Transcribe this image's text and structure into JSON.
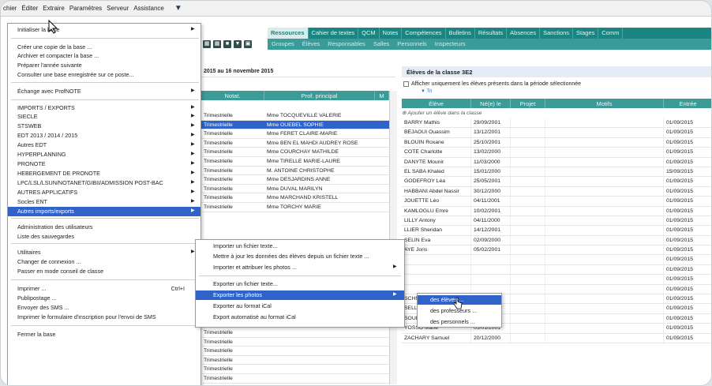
{
  "menubar": {
    "items": [
      "chier",
      "Éditer",
      "Extraire",
      "Paramètres",
      "Serveur",
      "Assistance"
    ]
  },
  "nav": {
    "tabs": [
      "Ressources",
      "Cahier de textes",
      "QCM",
      "Notes",
      "Compétences",
      "Bulletins",
      "Résultats",
      "Absences",
      "Sanctions",
      "Stages",
      "Comm"
    ],
    "subtabs": [
      "Groupes",
      "Élèves",
      "Responsables",
      "Salles",
      "Personnels",
      "Inspecteurs"
    ]
  },
  "file_menu": {
    "items": [
      {
        "label": "Initialiser la base",
        "arrow": "▶",
        "shortcut": ""
      },
      {
        "label": "Créer une copie de la base ...",
        "arrow": "",
        "shortcut": ""
      },
      {
        "label": "Archiver et compacter la base ...",
        "arrow": "",
        "shortcut": ""
      },
      {
        "label": "Préparer l'année suivante",
        "arrow": "",
        "shortcut": ""
      },
      {
        "label": "Consulter une base enregistrée sur ce poste...",
        "arrow": "",
        "shortcut": ""
      },
      {
        "label": "Échange avec ProfNOTE",
        "arrow": "▶",
        "shortcut": ""
      },
      {
        "label": "IMPORTS / EXPORTS",
        "arrow": "▶",
        "shortcut": ""
      },
      {
        "label": "SIECLE",
        "arrow": "▶",
        "shortcut": ""
      },
      {
        "label": "STSWEB",
        "arrow": "▶",
        "shortcut": ""
      },
      {
        "label": "EDT 2013 / 2014 / 2015",
        "arrow": "▶",
        "shortcut": ""
      },
      {
        "label": "Autres EDT",
        "arrow": "▶",
        "shortcut": ""
      },
      {
        "label": "HYPERPLANNING",
        "arrow": "▶",
        "shortcut": ""
      },
      {
        "label": "PRONOTE",
        "arrow": "▶",
        "shortcut": ""
      },
      {
        "label": "HEBERGEMENT DE PRONOTE",
        "arrow": "▶",
        "shortcut": ""
      },
      {
        "label": "LPC/LSL/LSUN/NOTANET/GIBII/ADMISSION POST-BAC",
        "arrow": "▶",
        "shortcut": ""
      },
      {
        "label": "AUTRES APPLICATIFS",
        "arrow": "▶",
        "shortcut": ""
      },
      {
        "label": "Socles ENT",
        "arrow": "▶",
        "shortcut": ""
      },
      {
        "label": "Autres imports/exports",
        "arrow": "▶",
        "shortcut": ""
      },
      {
        "label": "Administration des utilisateurs",
        "arrow": "",
        "shortcut": ""
      },
      {
        "label": "Liste des sauvegardes",
        "arrow": "",
        "shortcut": ""
      },
      {
        "label": "Utilitaires",
        "arrow": "▶",
        "shortcut": ""
      },
      {
        "label": "Changer de connexion ...",
        "arrow": "",
        "shortcut": ""
      },
      {
        "label": "Passer en mode conseil de classe",
        "arrow": "",
        "shortcut": ""
      },
      {
        "label": "Imprimer ...",
        "arrow": "",
        "shortcut": "Ctrl+I"
      },
      {
        "label": "Publipostage ...",
        "arrow": "",
        "shortcut": ""
      },
      {
        "label": "Envoyer des SMS ...",
        "arrow": "",
        "shortcut": ""
      },
      {
        "label": "Imprimer le formulaire d'inscription pour l'envoi de SMS",
        "arrow": "",
        "shortcut": ""
      },
      {
        "label": "Fermer la base",
        "arrow": "",
        "shortcut": ""
      }
    ]
  },
  "submenu": {
    "items": [
      {
        "label": "Importer un fichier texte...",
        "arrow": ""
      },
      {
        "label": "Mettre à jour les données des élèves depuis un fichier texte ...",
        "arrow": ""
      },
      {
        "label": "Importer et attribuer les photos ...",
        "arrow": "▶"
      },
      {
        "label": "Exporter un fichier texte...",
        "arrow": ""
      },
      {
        "label": "Exporter les photos",
        "arrow": "▶"
      },
      {
        "label": "Exporter au format iCal",
        "arrow": ""
      },
      {
        "label": "Export automatisé au format iCal",
        "arrow": ""
      }
    ]
  },
  "subsubmenu": {
    "items": [
      "des élèves ...",
      "des professeurs ...",
      "des personnels ..."
    ]
  },
  "middle_panel": {
    "header": "2015 au 16 novembre 2015",
    "col_notat": "Notat.",
    "col_prof": "Prof. principal",
    "col_m": "M",
    "rows": [
      {
        "notat": "Trimestrielle",
        "prof": "Mme TOCQUEVILLE VALERIE"
      },
      {
        "notat": "Trimestrielle",
        "prof": "Mme OUEBEL SOPHIE"
      },
      {
        "notat": "Trimestrielle",
        "prof": "Mme FERET CLAIRE-MARIE"
      },
      {
        "notat": "Trimestrielle",
        "prof": "Mme BEN EL MAHDI AUDREY ROSE"
      },
      {
        "notat": "Trimestrielle",
        "prof": "Mme COURCHAY MATHILDE"
      },
      {
        "notat": "Trimestrielle",
        "prof": "Mme TIRELLE MARIE-LAURE"
      },
      {
        "notat": "Trimestrielle",
        "prof": "M. ANTOINE CHRISTOPHE"
      },
      {
        "notat": "Trimestrielle",
        "prof": "Mme DESJARDINS ANNE"
      },
      {
        "notat": "Trimestrielle",
        "prof": "Mme DUVAL MARILYN"
      },
      {
        "notat": "Trimestrielle",
        "prof": "Mme MARCHAND KRISTELL"
      },
      {
        "notat": "Trimestrielle",
        "prof": "Mme TORCHY MARIE"
      }
    ],
    "bottom_rows": [
      "Trimestrielle",
      "Trimestrielle",
      "Trimestrielle",
      "Trimestrielle",
      "Trimestrielle",
      "Trimestrielle"
    ]
  },
  "right_panel": {
    "header": "Élèves de la classe 3E2",
    "checkbox_label": "Afficher uniquement les élèves présents dans la période sélectionnée",
    "sort_label": "Tri",
    "add_label": "Ajouter un élève dans la classe",
    "columns": [
      "Élève",
      "Né(e) le",
      "Projet",
      "Motifs",
      "Entrée"
    ],
    "rows": [
      {
        "name": "BARRY Mathis",
        "born": "29/09/2001",
        "entry": "01/09/2015"
      },
      {
        "name": "BEJAOUI Ouassim",
        "born": "13/12/2001",
        "entry": "01/09/2015"
      },
      {
        "name": "BLOUIN Roxane",
        "born": "25/10/2001",
        "entry": "01/09/2015"
      },
      {
        "name": "COTE Charlotte",
        "born": "13/02/2000",
        "entry": "01/09/2015"
      },
      {
        "name": "DANYTE Mounir",
        "born": "11/03/2000",
        "entry": "01/09/2015"
      },
      {
        "name": "EL SABA Khaled",
        "born": "15/01/2000",
        "entry": "15/09/2015"
      },
      {
        "name": "GODEFROY Léa",
        "born": "25/05/2001",
        "entry": "01/09/2015"
      },
      {
        "name": "HABBANI Abdel Nassir",
        "born": "30/12/2000",
        "entry": "01/09/2015"
      },
      {
        "name": "JOUETTE Léo",
        "born": "04/11/2001",
        "entry": "01/09/2015"
      },
      {
        "name": "KAMLOGLU Emre",
        "born": "10/02/2001",
        "entry": "01/09/2015"
      },
      {
        "name": "LILLY Antony",
        "born": "04/11/2000",
        "entry": "01/09/2015"
      },
      {
        "name": "LLIER Sheridan",
        "born": "14/12/2001",
        "entry": "01/09/2015"
      },
      {
        "name": "SELIN Eva",
        "born": "02/09/2000",
        "entry": "01/09/2015"
      },
      {
        "name": "AYE Joris",
        "born": "05/02/2001",
        "entry": "01/09/2015"
      },
      {
        "name": "",
        "born": "",
        "entry": "01/09/2015"
      },
      {
        "name": "",
        "born": "",
        "entry": "01/09/2015"
      },
      {
        "name": "",
        "born": "",
        "entry": "01/09/2015"
      },
      {
        "name": "",
        "born": "",
        "entry": "01/09/2015"
      },
      {
        "name": "SCHNEIDER Emma",
        "born": "17/04/2001",
        "entry": "01/09/2015"
      },
      {
        "name": "SELLIER Maryne",
        "born": "22/11/2000",
        "entry": "01/09/2015"
      },
      {
        "name": "SOUILLARD Océane",
        "born": "03/10/2001",
        "entry": "01/09/2015"
      },
      {
        "name": "YOSSO Marie",
        "born": "05/01/2001",
        "entry": "01/09/2015"
      },
      {
        "name": "ZACHARY Samuel",
        "born": "20/12/2000",
        "entry": "01/09/2015"
      }
    ]
  }
}
